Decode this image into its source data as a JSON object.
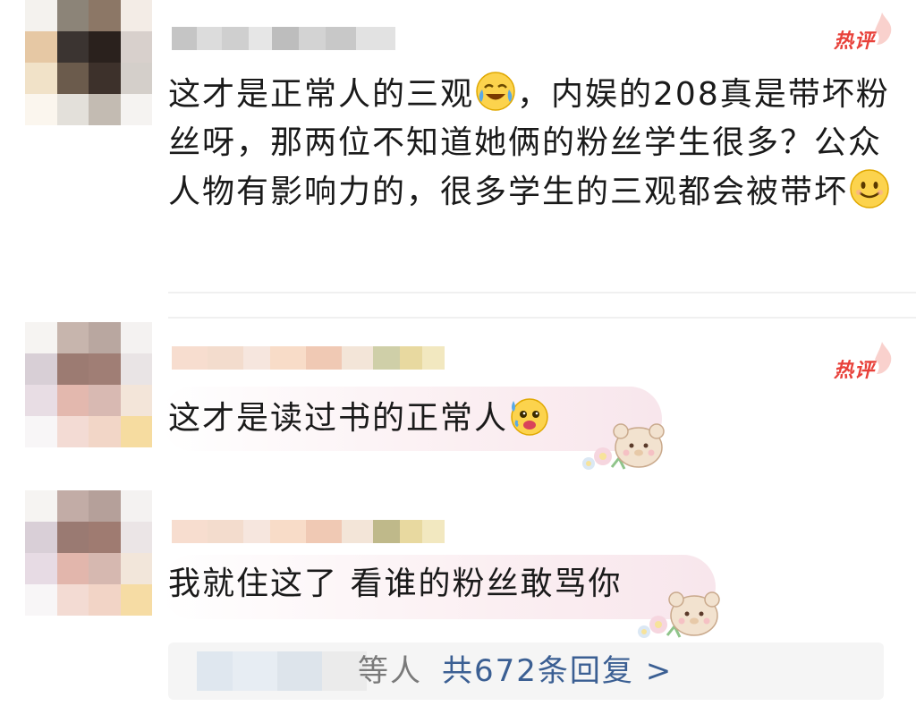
{
  "comments": [
    {
      "text_part1": "这才是正常人的三观",
      "text_part2": "，内娱的208真是带坏粉丝呀，那两位不知道她俩的粉丝学生很多？公众人物有影响力的，很多学生的三观都会被带坏",
      "emoji1": "laughing-crying-emoji",
      "emoji2": "smile-emoji",
      "badge": "热评"
    },
    {
      "text": "这才是读过书的正常人",
      "emoji": "sweat-emoji",
      "badge": "热评",
      "decoration": "bear-flower-sticker"
    },
    {
      "text": "我就住这了 看谁的粉丝敢骂你",
      "decoration": "bear-flower-sticker"
    }
  ],
  "replies": {
    "suffix": "等人",
    "link": "共672条回复 >"
  },
  "colors": {
    "hot_badge": "#e8413a",
    "reply_link": "#3b5f93",
    "reply_bg": "#f5f5f5"
  }
}
